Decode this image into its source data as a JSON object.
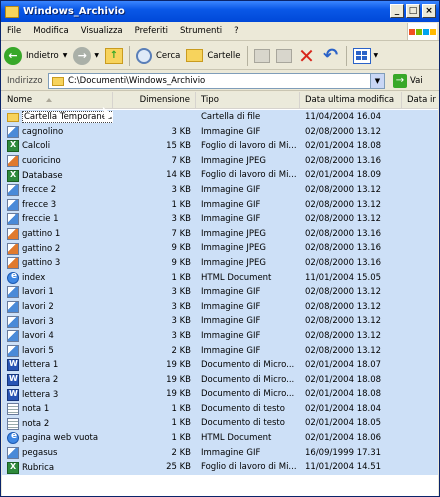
{
  "window": {
    "title": "Windows_Archivio"
  },
  "menu": [
    "File",
    "Modifica",
    "Visualizza",
    "Preferiti",
    "Strumenti",
    "?"
  ],
  "toolbar": {
    "back_label": "Indietro",
    "search_label": "Cerca",
    "folders_label": "Cartelle"
  },
  "address": {
    "label": "Indirizzo",
    "value": "C:\\Documenti\\Windows_Archivio",
    "go_label": "Vai"
  },
  "columns": {
    "name": "Nome",
    "size": "Dimensione",
    "type": "Tipo",
    "modified": "Data ultima modifica",
    "accessed": "Data ir"
  },
  "files": [
    {
      "name": "Cartella Temporanea",
      "size": "",
      "type": "Cartella di file",
      "date": "11/04/2004 16.04",
      "icon": "folder"
    },
    {
      "name": "cagnolino",
      "size": "3 KB",
      "type": "Immagine GIF",
      "date": "02/08/2000 13.12",
      "icon": "gif"
    },
    {
      "name": "Calcoli",
      "size": "15 KB",
      "type": "Foglio di lavoro di Mi...",
      "date": "02/01/2004 18.08",
      "icon": "xls"
    },
    {
      "name": "cuoricino",
      "size": "7 KB",
      "type": "Immagine JPEG",
      "date": "02/08/2000 13.16",
      "icon": "jpeg"
    },
    {
      "name": "Database",
      "size": "14 KB",
      "type": "Foglio di lavoro di Mi...",
      "date": "02/01/2004 18.09",
      "icon": "xls"
    },
    {
      "name": "frecce 2",
      "size": "3 KB",
      "type": "Immagine GIF",
      "date": "02/08/2000 13.12",
      "icon": "gif"
    },
    {
      "name": "frecce 3",
      "size": "1 KB",
      "type": "Immagine GIF",
      "date": "02/08/2000 13.12",
      "icon": "gif"
    },
    {
      "name": "freccie 1",
      "size": "3 KB",
      "type": "Immagine GIF",
      "date": "02/08/2000 13.12",
      "icon": "gif"
    },
    {
      "name": "gattino 1",
      "size": "7 KB",
      "type": "Immagine JPEG",
      "date": "02/08/2000 13.16",
      "icon": "jpeg"
    },
    {
      "name": "gattino 2",
      "size": "9 KB",
      "type": "Immagine JPEG",
      "date": "02/08/2000 13.16",
      "icon": "jpeg"
    },
    {
      "name": "gattino 3",
      "size": "9 KB",
      "type": "Immagine JPEG",
      "date": "02/08/2000 13.16",
      "icon": "jpeg"
    },
    {
      "name": "index",
      "size": "1 KB",
      "type": "HTML Document",
      "date": "11/01/2004 15.05",
      "icon": "html"
    },
    {
      "name": "lavori 1",
      "size": "3 KB",
      "type": "Immagine GIF",
      "date": "02/08/2000 13.12",
      "icon": "gif"
    },
    {
      "name": "lavori 2",
      "size": "3 KB",
      "type": "Immagine GIF",
      "date": "02/08/2000 13.12",
      "icon": "gif"
    },
    {
      "name": "lavori 3",
      "size": "3 KB",
      "type": "Immagine GIF",
      "date": "02/08/2000 13.12",
      "icon": "gif"
    },
    {
      "name": "lavori 4",
      "size": "3 KB",
      "type": "Immagine GIF",
      "date": "02/08/2000 13.12",
      "icon": "gif"
    },
    {
      "name": "lavori 5",
      "size": "2 KB",
      "type": "Immagine GIF",
      "date": "02/08/2000 13.12",
      "icon": "gif"
    },
    {
      "name": "lettera 1",
      "size": "19 KB",
      "type": "Documento di Micro...",
      "date": "02/01/2004 18.07",
      "icon": "doc"
    },
    {
      "name": "lettera 2",
      "size": "19 KB",
      "type": "Documento di Micro...",
      "date": "02/01/2004 18.08",
      "icon": "doc"
    },
    {
      "name": "lettera 3",
      "size": "19 KB",
      "type": "Documento di Micro...",
      "date": "02/01/2004 18.08",
      "icon": "doc"
    },
    {
      "name": "nota 1",
      "size": "1 KB",
      "type": "Documento di testo",
      "date": "02/01/2004 18.04",
      "icon": "txt"
    },
    {
      "name": "nota 2",
      "size": "1 KB",
      "type": "Documento di testo",
      "date": "02/01/2004 18.05",
      "icon": "txt"
    },
    {
      "name": "pagina web vuota",
      "size": "1 KB",
      "type": "HTML Document",
      "date": "02/01/2004 18.06",
      "icon": "html"
    },
    {
      "name": "pegasus",
      "size": "2 KB",
      "type": "Immagine GIF",
      "date": "16/09/1999 17.31",
      "icon": "gif"
    },
    {
      "name": "Rubrica",
      "size": "25 KB",
      "type": "Foglio di lavoro di Mi...",
      "date": "11/01/2004 14.51",
      "icon": "xls"
    }
  ]
}
